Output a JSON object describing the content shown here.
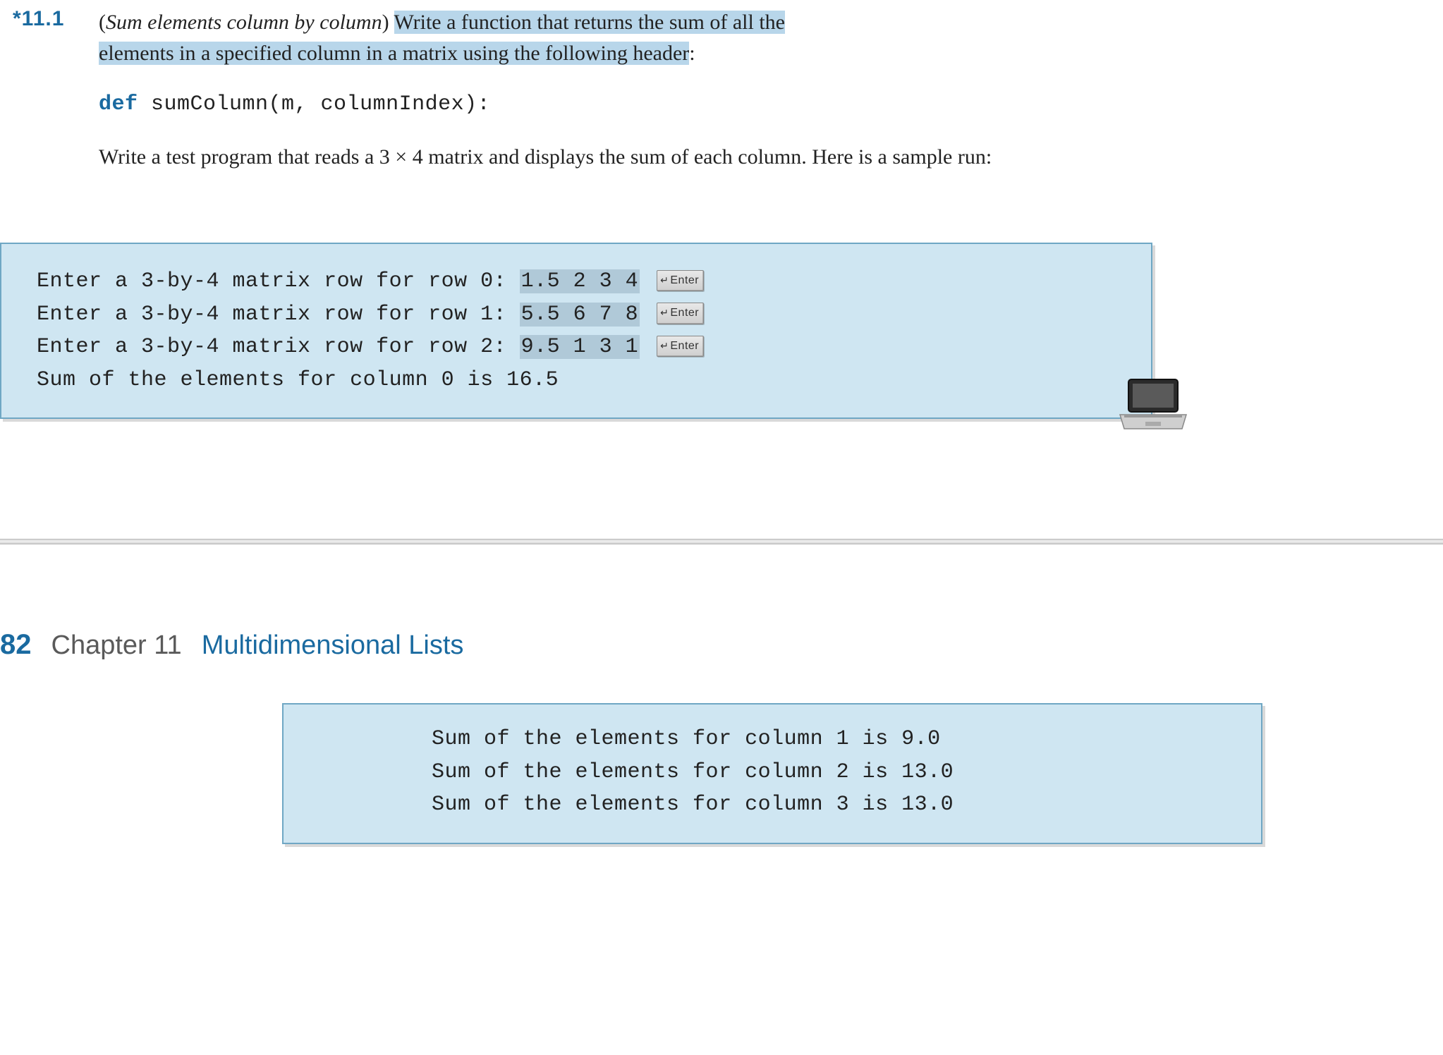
{
  "exercise": {
    "label": "*11.1",
    "title_italic": "Sum elements column by column",
    "prompt_part1_hl": "Write a function that returns the sum of all the ",
    "prompt_part2_hl": "elements in a specified column in a matrix using the following header",
    "prompt_colon": ":",
    "code_def_kw": "def",
    "code_rest": " sumColumn(m, columnIndex):",
    "paragraph2": "Write a test program that reads a 3 × 4 matrix and displays the sum of each column. Here is a sample run:"
  },
  "sample1": {
    "lines": [
      {
        "prompt": "Enter a 3-by-4 matrix row for row 0: ",
        "input": "1.5 2 3 4",
        "enter": true
      },
      {
        "prompt": "Enter a 3-by-4 matrix row for row 1: ",
        "input": "5.5 6 7 8",
        "enter": true
      },
      {
        "prompt": "Enter a 3-by-4 matrix row for row 2: ",
        "input": "9.5 1 3 1",
        "enter": true
      },
      {
        "prompt": "Sum of the elements for column 0 is 16.5",
        "input": "",
        "enter": false
      }
    ],
    "enter_label": "Enter"
  },
  "chapter": {
    "page_number": "82",
    "chapter_label": "Chapter 11",
    "chapter_title": "Multidimensional Lists"
  },
  "sample2": {
    "lines": [
      "Sum of the elements for column 1 is 9.0",
      "Sum of the elements for column 2 is 13.0",
      "Sum of the elements for column 3 is 13.0"
    ]
  },
  "icons": {
    "laptop": "laptop-icon"
  }
}
